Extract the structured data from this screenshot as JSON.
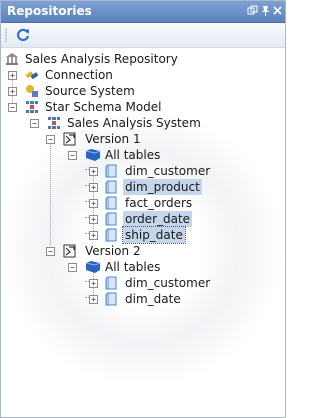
{
  "panel": {
    "title": "Repositories"
  },
  "tree": {
    "root": "Sales Analysis Repository",
    "connection": "Connection",
    "source_system": "Source System",
    "star_schema_model": "Star Schema Model",
    "sales_analysis_system": "Sales Analysis System",
    "version1": {
      "label": "Version 1",
      "all_tables": "All tables",
      "tables": [
        "dim_customer",
        "dim_product",
        "fact_orders",
        "order_date",
        "ship_date"
      ]
    },
    "version2": {
      "label": "Version 2",
      "all_tables": "All tables",
      "tables": [
        "dim_customer",
        "dim_date"
      ]
    }
  },
  "colors": {
    "titlebar": "#5b82be",
    "selection": "#c5d5ec"
  }
}
